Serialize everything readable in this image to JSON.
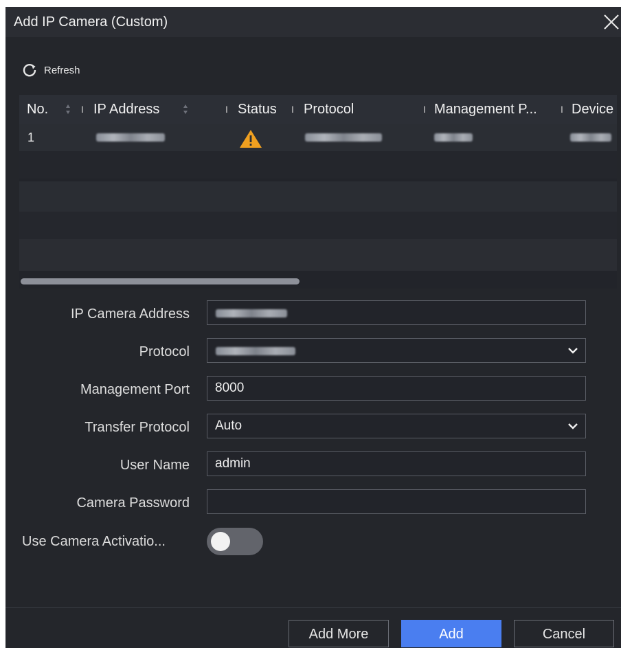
{
  "dialog": {
    "title": "Add IP Camera (Custom)",
    "close_icon": "close-icon"
  },
  "toolbar": {
    "refresh_label": "Refresh",
    "refresh_icon": "refresh-icon"
  },
  "table": {
    "columns": [
      "No.",
      "IP Address",
      "Status",
      "Protocol",
      "Management P...",
      "Device"
    ],
    "rows": [
      {
        "no": "1",
        "status_icon": "warning-icon"
      }
    ]
  },
  "form": {
    "ip_camera_address_label": "IP Camera Address",
    "protocol_label": "Protocol",
    "management_port_label": "Management Port",
    "management_port_value": "8000",
    "transfer_protocol_label": "Transfer Protocol",
    "transfer_protocol_value": "Auto",
    "user_name_label": "User Name",
    "user_name_value": "admin",
    "camera_password_label": "Camera Password",
    "camera_password_value": "",
    "activation_label": "Use Camera Activatio...",
    "activation_enabled": false
  },
  "footer": {
    "add_more_label": "Add More",
    "add_label": "Add",
    "cancel_label": "Cancel"
  },
  "colors": {
    "accent": "#4a7ef0",
    "warning": "#f0a020",
    "background": "#24262b"
  }
}
